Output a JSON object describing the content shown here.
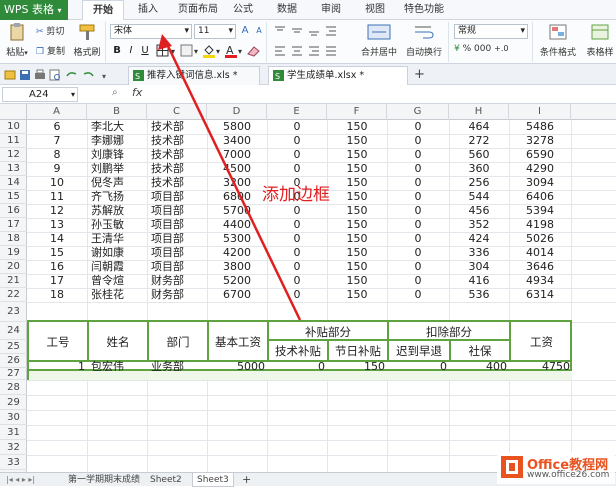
{
  "app": {
    "name": "WPS 表格"
  },
  "ribbon_tabs": [
    "开始",
    "插入",
    "页面布局",
    "公式",
    "数据",
    "审阅",
    "视图",
    "特色功能"
  ],
  "ribbon": {
    "paste": "粘贴",
    "cut": "剪切",
    "copy": "复制",
    "format_painter": "格式刷",
    "font_name": "宋体",
    "font_size": "11",
    "merge_center": "合并居中",
    "wrap_text": "自动换行",
    "number_format": "常规",
    "cond_format": "条件格式",
    "table_format": "表格样"
  },
  "doc_tabs": [
    {
      "label": "推荐入键词信息.xls *"
    },
    {
      "label": "学生成绩单.xlsx *"
    }
  ],
  "formula_bar": {
    "cell_ref": "A24",
    "fx": "fx"
  },
  "columns": [
    "A",
    "B",
    "C",
    "D",
    "E",
    "F",
    "G",
    "H",
    "I"
  ],
  "rows": [
    [
      "6",
      "李北大",
      "技术部",
      "5800",
      "0",
      "150",
      "0",
      "464",
      "5486"
    ],
    [
      "7",
      "李娜娜",
      "技术部",
      "3400",
      "0",
      "150",
      "0",
      "272",
      "3278"
    ],
    [
      "8",
      "刘康锋",
      "技术部",
      "7000",
      "0",
      "150",
      "0",
      "560",
      "6590"
    ],
    [
      "9",
      "刘鹏举",
      "技术部",
      "4500",
      "0",
      "150",
      "0",
      "360",
      "4290"
    ],
    [
      "10",
      "倪冬声",
      "技术部",
      "3200",
      "0",
      "150",
      "0",
      "256",
      "3094"
    ],
    [
      "11",
      "齐飞扬",
      "项目部",
      "6800",
      "0",
      "150",
      "0",
      "544",
      "6406"
    ],
    [
      "12",
      "苏解放",
      "项目部",
      "5700",
      "0",
      "150",
      "0",
      "456",
      "5394"
    ],
    [
      "13",
      "孙玉敏",
      "项目部",
      "4400",
      "0",
      "150",
      "0",
      "352",
      "4198"
    ],
    [
      "14",
      "王清华",
      "项目部",
      "5300",
      "0",
      "150",
      "0",
      "424",
      "5026"
    ],
    [
      "15",
      "谢如康",
      "项目部",
      "4200",
      "0",
      "150",
      "0",
      "336",
      "4014"
    ],
    [
      "16",
      "闫朝霞",
      "项目部",
      "3800",
      "0",
      "150",
      "0",
      "304",
      "3646"
    ],
    [
      "17",
      "曾令煊",
      "财务部",
      "5200",
      "0",
      "150",
      "0",
      "416",
      "4934"
    ],
    [
      "18",
      "张桂花",
      "财务部",
      "6700",
      "0",
      "150",
      "0",
      "536",
      "6314"
    ]
  ],
  "row_numbers": [
    "10",
    "11",
    "12",
    "13",
    "14",
    "15",
    "16",
    "17",
    "18",
    "19",
    "20",
    "21",
    "22",
    "23",
    "24",
    "25",
    "26",
    "27",
    "28",
    "29",
    "30",
    "31",
    "32",
    "33"
  ],
  "salary_table": {
    "h_id": "工号",
    "h_name": "姓名",
    "h_dept": "部门",
    "h_base": "基本工资",
    "h_allow": "补贴部分",
    "h_tech": "技术补贴",
    "h_holiday": "节日补贴",
    "h_deduct": "扣除部分",
    "h_late": "迟到早退",
    "h_ins": "社保",
    "h_salary": "工资",
    "r_id": "1",
    "r_name": "包宏伟",
    "r_dept": "业务部",
    "r_base": "5000",
    "r_tech": "0",
    "r_holiday": "150",
    "r_late": "0",
    "r_ins": "400",
    "r_salary": "4750"
  },
  "annotation": "添加边框",
  "sheet_tabs": [
    "第一学期期末成绩",
    "Sheet2",
    "Sheet3"
  ],
  "watermark": {
    "brand": "Office教程网",
    "url": "www.office26.com"
  },
  "colors": {
    "accent_green": "#5fa341",
    "annotation_red": "#e02020",
    "app_green": "#2f8a3a"
  }
}
